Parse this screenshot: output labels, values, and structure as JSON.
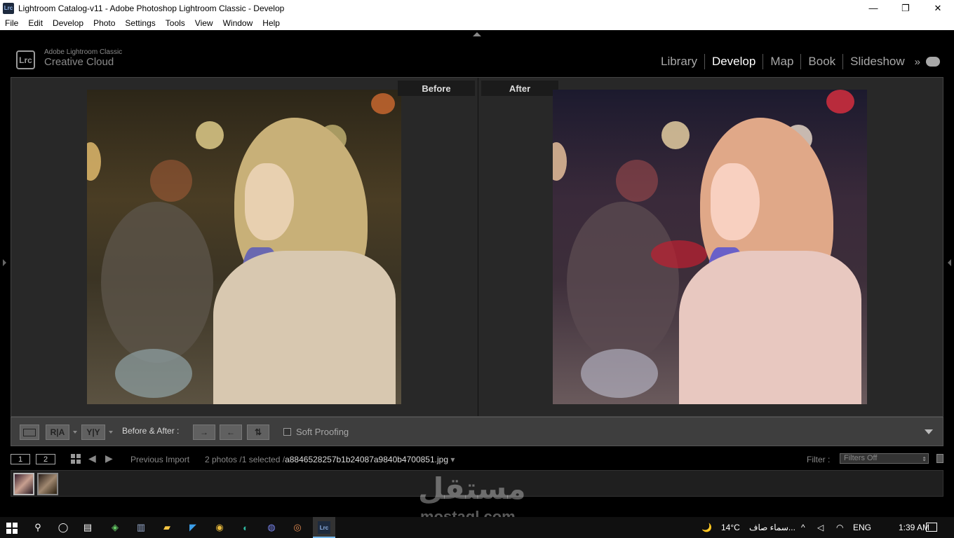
{
  "window": {
    "app_icon": "Lrc",
    "title": "Lightroom Catalog-v11 - Adobe Photoshop Lightroom Classic - Develop",
    "minimize": "—",
    "maximize": "❐",
    "close": "✕"
  },
  "menu": [
    "File",
    "Edit",
    "Develop",
    "Photo",
    "Settings",
    "Tools",
    "View",
    "Window",
    "Help"
  ],
  "identity": {
    "logo": "Lrc",
    "product": "Adobe Lightroom Classic",
    "plan": "Creative Cloud"
  },
  "modules": [
    "Library",
    "Develop",
    "Map",
    "Book",
    "Slideshow"
  ],
  "modules_more": "»",
  "active_module": "Develop",
  "compare": {
    "before_label": "Before",
    "after_label": "After"
  },
  "toolbar": {
    "view_loupe": "",
    "view_ra": "R|A",
    "view_yy": "Y|Y",
    "before_after_label": "Before & After :",
    "copy_before_to_after": "→",
    "copy_after_to_before": "←",
    "swap": "⇅",
    "soft_proofing": "Soft Proofing"
  },
  "filmstrip": {
    "screen1": "1",
    "screen2": "2",
    "source": "Previous Import",
    "count": "2 photos /1 selected /",
    "filename": "a8846528257b1b24087a9840b4700851.jpg",
    "filter_label": "Filter :",
    "filter_value": "Filters Off"
  },
  "watermark": {
    "arabic": "مستقل",
    "latin": "mostaql.com"
  },
  "taskbar": {
    "weather_icon": "🌙",
    "temperature": "14°C",
    "weather_text": "سماء صاف...",
    "language": "ENG",
    "time": "1:39 AM"
  },
  "colors": {
    "active_module": "#ffffff",
    "inactive_module": "#a8a8a8",
    "panel_bg": "#282828",
    "toolbar_bg": "#3e3e3e"
  }
}
